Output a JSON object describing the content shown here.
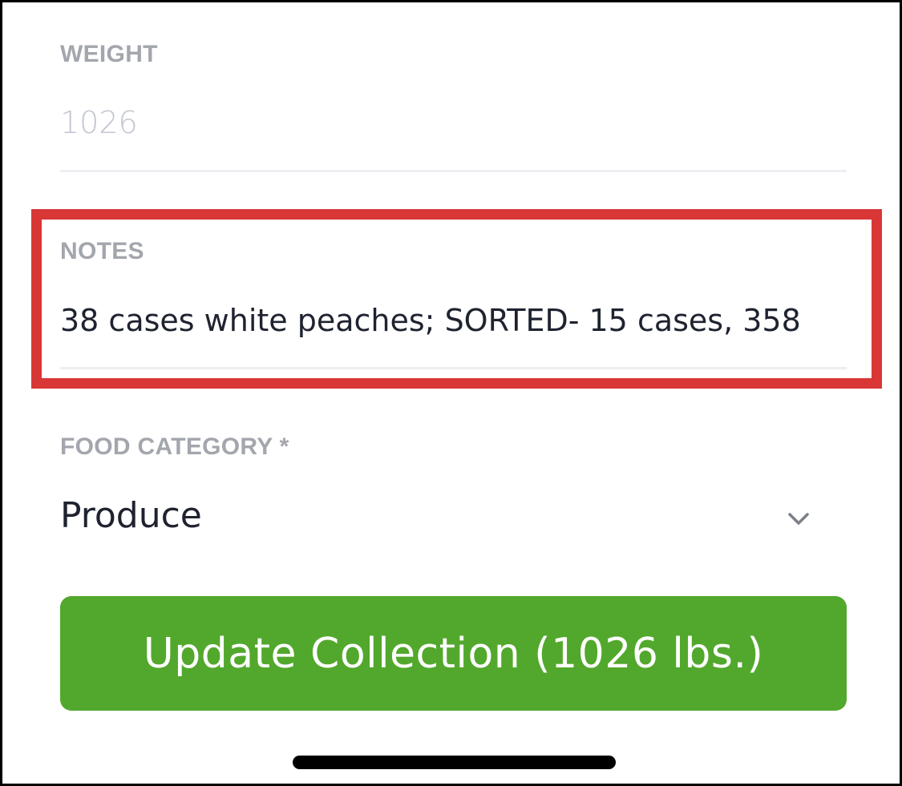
{
  "form": {
    "weight": {
      "label": "WEIGHT",
      "value": "1026"
    },
    "notes": {
      "label": "NOTES",
      "value": "38 cases white peaches; SORTED- 15 cases, 358"
    },
    "food_category": {
      "label": "FOOD CATEGORY *",
      "selected": "Produce",
      "icon": "chevron-down-icon"
    }
  },
  "actions": {
    "update_label": "Update Collection (1026 lbs.)"
  },
  "highlight": {
    "target": "notes",
    "color": "#d93636"
  },
  "colors": {
    "accent": "#52a82c",
    "label": "#a3a6ad",
    "text": "#1f2330"
  }
}
